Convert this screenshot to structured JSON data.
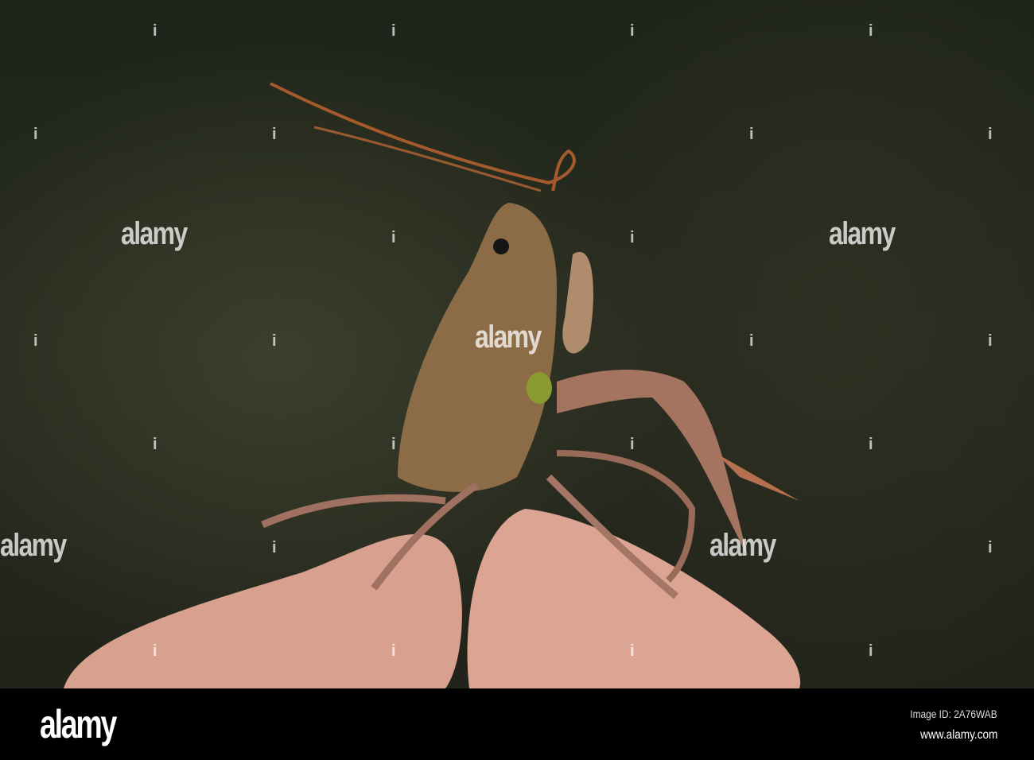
{
  "watermark": {
    "text": "alamy",
    "mark": "i"
  },
  "footer": {
    "logo": "alamy",
    "image_id": "Image ID: 2A76WAB",
    "url": "www.alamy.com"
  },
  "colors": {
    "background": "#22261b",
    "crayfish": "#8a6a45",
    "finger": "#d9a08c"
  }
}
